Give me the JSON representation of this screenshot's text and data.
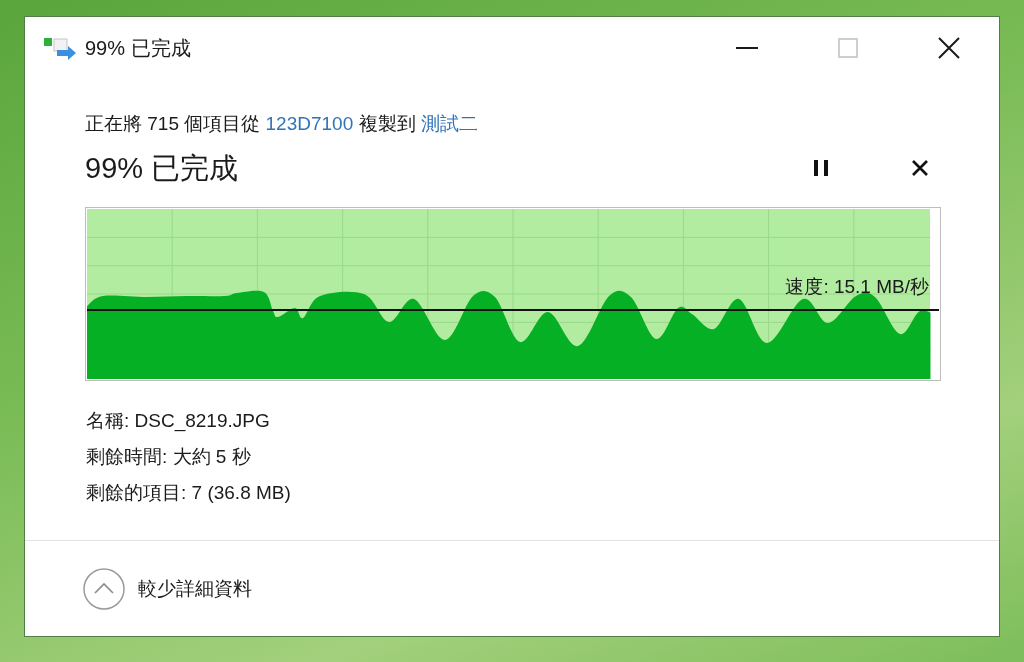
{
  "window": {
    "title": "99% 已完成",
    "controls": [
      {
        "kind": "minimize",
        "disabled": false
      },
      {
        "kind": "maximize",
        "disabled": true
      },
      {
        "kind": "close",
        "disabled": false
      }
    ]
  },
  "summary": {
    "parts": [
      {
        "kind": "text",
        "text": "正在將 715 個項目從"
      },
      {
        "kind": "link",
        "text": "123D7100"
      },
      {
        "kind": "text",
        "text": "複製到"
      },
      {
        "kind": "link",
        "text": "測試二"
      }
    ]
  },
  "status": "99% 已完成",
  "progress": {
    "level": 0.99,
    "speed": "速度: 15.1 MB/秒"
  },
  "details": [
    "名稱: DSC_8219.JPG",
    "剩餘時間: 大約 5 秒",
    "剩餘的項目: 7 (36.8 MB)"
  ],
  "details_toggle": {
    "label": "較少詳細資料",
    "expanded": true
  }
}
